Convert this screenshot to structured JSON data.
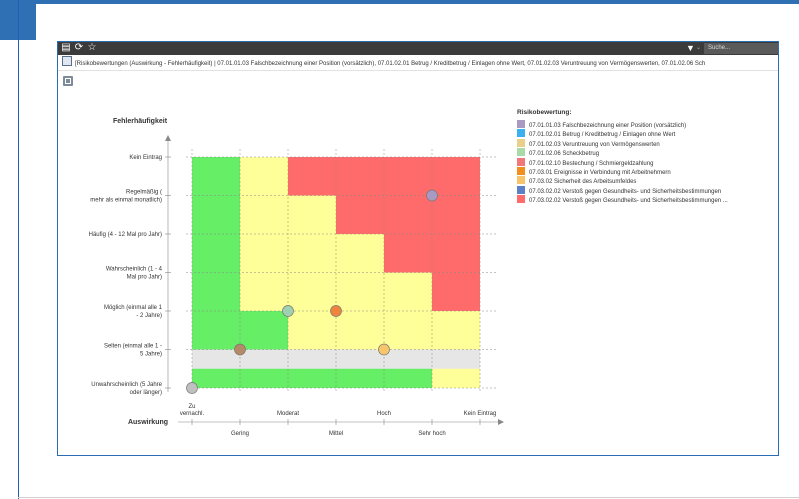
{
  "toolbar": {
    "search_placeholder": "Suche..."
  },
  "title": "[Risikobewertungen (Auswirkung - Fehlerhäufigkeit) | 07.01.01.03 Falschbezeichnung einer Position (vorsätzlich), 07.01.02.01 Betrug / Kreditbetrug / Einlagen ohne Wert, 07.01.02.03 Veruntreuung von Vermögenswerten, 07.01.02.06 Sch",
  "chart_data": {
    "type": "scatter",
    "ylabel": "Fehlerhäufigkeit",
    "xlabel": "Auswirkung",
    "y_categories": [
      "Unwahrscheinlich (5 Jahre oder länger)",
      "Selten (einmal alle 1 - 5 Jahre)",
      "Möglich (einmal alle 1 - 2 Jahre)",
      "Wahrscheinlich (1 - 4 Mal pro Jahr)",
      "Häufig (4 - 12 Mal pro Jahr)",
      "Regelmäßig ( mehr als einmal monatlich)",
      "Kein Eintrag"
    ],
    "y_label_lines": [
      [
        "Unwahrscheinlich (5 Jahre",
        "oder länger)"
      ],
      [
        "Selten (einmal alle 1 -",
        "5 Jahre)"
      ],
      [
        "Möglich (einmal alle 1",
        "- 2 Jahre)"
      ],
      [
        "Wahrscheinlich (1 - 4",
        "Mal pro Jahr)"
      ],
      [
        "Häufig (4 - 12 Mal pro Jahr)"
      ],
      [
        "Regelmäßig (",
        "mehr als einmal monatlich)"
      ],
      [
        "Kein Eintrag"
      ]
    ],
    "x_categories": [
      "Zu vernachl.",
      "Gering",
      "Moderat",
      "Mittel",
      "Hoch",
      "Sehr hoch",
      "Kein Eintrag"
    ],
    "x_label_lines": [
      [
        "Zu",
        "vernachl."
      ],
      [
        "Gering"
      ],
      [
        "Moderat"
      ],
      [
        "Mittel"
      ],
      [
        "Hoch"
      ],
      [
        "Sehr hoch"
      ],
      [
        "Kein Eintrag"
      ]
    ],
    "heatmap_rows_bottom_to_top": [
      [
        "green",
        "green",
        "green",
        "green",
        "green",
        "yellow"
      ],
      [
        "green",
        "green",
        "yellow",
        "yellow",
        "yellow",
        "yellow"
      ],
      [
        "green",
        "yellow",
        "yellow",
        "yellow",
        "yellow",
        "red"
      ],
      [
        "green",
        "yellow",
        "yellow",
        "yellow",
        "red",
        "red"
      ],
      [
        "green",
        "yellow",
        "yellow",
        "red",
        "red",
        "red"
      ],
      [
        "green",
        "yellow",
        "red",
        "red",
        "red",
        "red"
      ]
    ],
    "zone_colors": {
      "green": "#66ee66",
      "yellow": "#ffff99",
      "red": "#ff6b6b",
      "none": "#e6e6e6"
    },
    "points": [
      {
        "x": "Zu vernachl.",
        "y": "Unwahrscheinlich (5 Jahre oder länger)",
        "color": "#c0c0c0"
      },
      {
        "x": "Gering",
        "y": "Selten (einmal alle 1 - 5 Jahre)",
        "color": "#b58a66"
      },
      {
        "x": "Moderat",
        "y": "Möglich (einmal alle 1 - 2 Jahre)",
        "color": "#9fd0b0"
      },
      {
        "x": "Mittel",
        "y": "Möglich (einmal alle 1 - 2 Jahre)",
        "color": "#f0843c"
      },
      {
        "x": "Hoch",
        "y": "Selten (einmal alle 1 - 5 Jahre)",
        "color": "#f7c66a"
      },
      {
        "x": "Sehr hoch",
        "y": "Regelmäßig ( mehr als einmal monatlich)",
        "color": "#a99ac4"
      }
    ]
  },
  "legend": {
    "title": "Risikobewertung:",
    "items": [
      {
        "label": "07.01.01.03 Falschbezeichnung einer Position (vorsätzlich)",
        "color": "#a99ac4"
      },
      {
        "label": "07.01.02.01 Betrug / Kreditbetrug / Einlagen ohne Wert",
        "color": "#3ab0f0"
      },
      {
        "label": "07.01.02.03 Veruntreuung von Vermögenswerten",
        "color": "#e8cf8a"
      },
      {
        "label": "07.01.02.06 Scheckbetrug",
        "color": "#a8dba8"
      },
      {
        "label": "07.01.02.10 Bestechung / Schmiergeldzahlung",
        "color": "#f07878"
      },
      {
        "label": "07.03.01 Ereignisse in Verbindung mit Arbeitnehmern",
        "color": "#f0901e"
      },
      {
        "label": "07.03.02 Sicherheit des Arbeitsumfeldes",
        "color": "#f7c66a"
      },
      {
        "label": "07.03.02.02 Verstoß gegen Gesundheits- und Sicherheitsbestimmungen",
        "color": "#5b82c8"
      },
      {
        "label": "07.03.02.02 Verstoß gegen Gesundheits- und Sicherheitsbestimmungen ...",
        "color": "#ff6b6b"
      }
    ]
  }
}
